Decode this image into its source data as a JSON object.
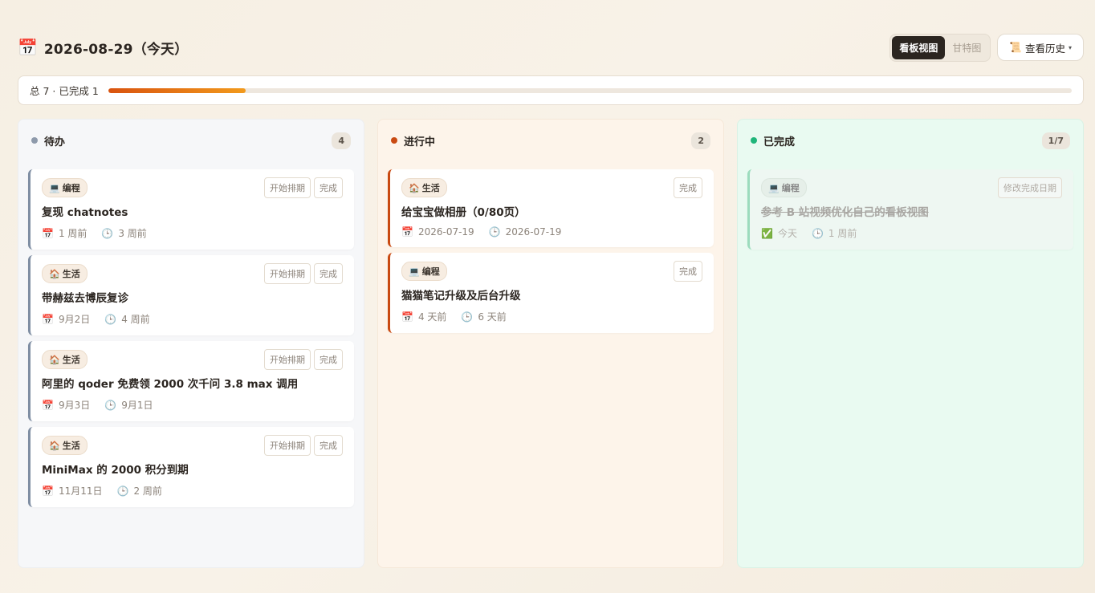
{
  "header": {
    "title": "2026-08-29（今天）",
    "title_icon": "📅",
    "view_kanban": "看板视图",
    "view_gantt": "甘特图",
    "history_icon": "📜",
    "history_label": "查看历史",
    "history_caret": "▾"
  },
  "progress": {
    "text": "总 7 · 已完成 1",
    "completed": 1,
    "total": 7
  },
  "columns": {
    "todo": {
      "title": "待办",
      "count": "4",
      "dot_color": "#8e9aab",
      "cards": [
        {
          "tag_icon": "💻",
          "tag": "编程",
          "title": "复现 chatnotes",
          "date_icon": "📅",
          "date": "1 周前",
          "due_icon": "🕒",
          "due": "3 周前",
          "btn1": "开始排期",
          "btn2": "完成"
        },
        {
          "tag_icon": "🏠",
          "tag": "生活",
          "title": "带赫兹去博辰复诊",
          "date_icon": "📅",
          "date": "9月2日",
          "due_icon": "🕒",
          "due": "4 周前",
          "btn1": "开始排期",
          "btn2": "完成"
        },
        {
          "tag_icon": "🏠",
          "tag": "生活",
          "title": "阿里的 qoder 免费领 2000 次千问 3.8 max 调用",
          "date_icon": "📅",
          "date": "9月3日",
          "due_icon": "🕒",
          "due": "9月1日",
          "btn1": "开始排期",
          "btn2": "完成"
        },
        {
          "tag_icon": "🏠",
          "tag": "生活",
          "title": "MiniMax 的 2000 积分到期",
          "date_icon": "📅",
          "date": "11月11日",
          "due_icon": "🕒",
          "due": "2 周前",
          "btn1": "开始排期",
          "btn2": "完成"
        }
      ]
    },
    "doing": {
      "title": "进行中",
      "count": "2",
      "dot_color": "#c94a12",
      "cards": [
        {
          "tag_icon": "🏠",
          "tag": "生活",
          "title": "给宝宝做相册（0/80页）",
          "date_icon": "📅",
          "date": "2026-07-19",
          "due_icon": "🕒",
          "due": "2026-07-19",
          "btn1": "完成"
        },
        {
          "tag_icon": "💻",
          "tag": "编程",
          "title": "猫猫笔记升级及后台升级",
          "date_icon": "📅",
          "date": "4 天前",
          "due_icon": "🕒",
          "due": "6 天前",
          "btn1": "完成"
        }
      ]
    },
    "done": {
      "title": "已完成",
      "count": "1/7",
      "dot_color": "#1fb57a",
      "cards": [
        {
          "tag_icon": "💻",
          "tag": "编程",
          "title": "参考 B 站视频优化自己的看板视图",
          "date_icon": "✅",
          "date": "今天",
          "due_icon": "🕒",
          "due": "1 周前",
          "btn1": "修改完成日期"
        }
      ]
    }
  }
}
